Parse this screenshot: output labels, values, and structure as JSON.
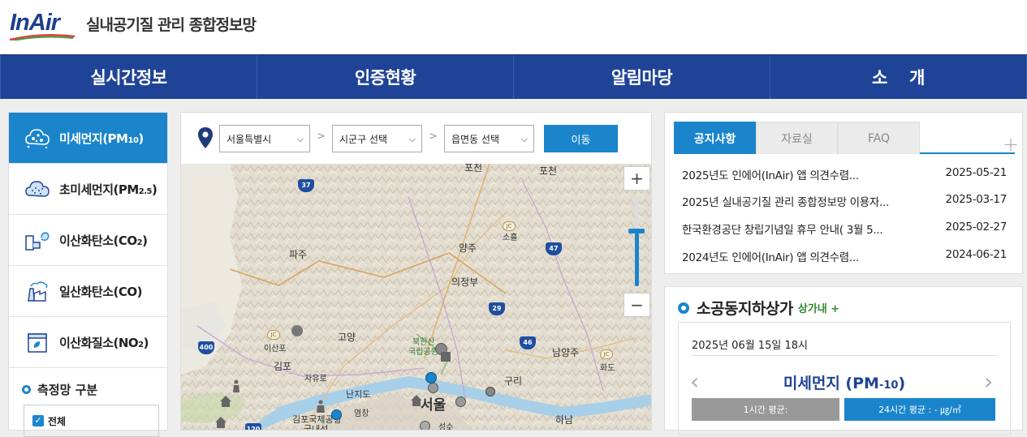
{
  "header": {
    "logo_text": "InAir",
    "site_title": "실내공기질 관리 종합정보망"
  },
  "nav": [
    "실시간정보",
    "인증현황",
    "알림마당",
    "소    개"
  ],
  "sidebar": {
    "items": [
      {
        "label": "미세먼지(PM",
        "sub": "10",
        "end": ")",
        "icon": "particle-cloud-icon",
        "active": true
      },
      {
        "label": "초미세먼지(PM",
        "sub": "2.5",
        "end": ")",
        "icon": "fine-dust-cloud-icon",
        "active": false
      },
      {
        "label": "이산화탄소(CO",
        "sub": "2",
        "end": ")",
        "icon": "co2-icon",
        "active": false
      },
      {
        "label": "일산화탄소(CO)",
        "sub": "",
        "end": "",
        "icon": "factory-icon",
        "active": false
      },
      {
        "label": "이산화질소(NO",
        "sub": "2",
        "end": ")",
        "icon": "no2-container-icon",
        "active": false
      }
    ],
    "network_title": "측정망 구분",
    "network_all": "전체"
  },
  "filter": {
    "sido": "서울특별시",
    "sigungu": "시군구 선택",
    "dong": "읍면동 선택",
    "sep": ">",
    "move_button": "이동"
  },
  "map": {
    "labels": {
      "pocheon": "포천",
      "paju": "파주",
      "yangju": "양주",
      "soheul": "소흘",
      "uijeongbu": "의정부",
      "goyang": "고양",
      "isanpo": "이산포",
      "bukhansan": "북한산",
      "national_park": "국립공원",
      "namyangju": "남양주",
      "hwado": "화도",
      "gimpo": "김포",
      "jayuro": "자유로",
      "guri": "구리",
      "nanjido": "난지도",
      "seoul": "서울",
      "hanam": "하남",
      "seongsu": "성수",
      "gimpo_airport": "김포국제공항",
      "gukne": "국내선",
      "yeomchang": "염창"
    },
    "highways": [
      "37",
      "47",
      "29",
      "46",
      "400",
      "120"
    ],
    "junction": "JC",
    "zoom_in": "+",
    "zoom_out": "−",
    "zoom_level": 0.62
  },
  "notice": {
    "tabs": [
      "공지사항",
      "자료실",
      "FAQ"
    ],
    "active_tab": "공지사항",
    "more": "+",
    "rows": [
      {
        "title": "2025년도 인에어(InAir) 앱 의견수렴...",
        "date": "2025-05-21"
      },
      {
        "title": "2025년 실내공기질 관리 종합정보망 이용자...",
        "date": "2025-03-17"
      },
      {
        "title": "한국환경공단 창립기념일 휴무 안내( 3월 5...",
        "date": "2025-02-27"
      },
      {
        "title": "2024년도 인에어(InAir) 앱 의견수렴...",
        "date": "2024-06-21"
      }
    ]
  },
  "station": {
    "name": "소공동지하상가",
    "tag": "상가내 +",
    "datetime": "2025년 06월 15일 18시",
    "pollutant": "미세먼지 (PM",
    "pollutant_sub": "-10",
    "pollutant_end": ")",
    "prev": "‹",
    "next": "›",
    "avg_1h": "1시간 평균:",
    "avg_24h": "24시간 평균 : - ㎍/㎥"
  },
  "colors": {
    "nav": "#1f4497",
    "accent": "#1b85cc",
    "green_tag": "#2e8b2e"
  }
}
